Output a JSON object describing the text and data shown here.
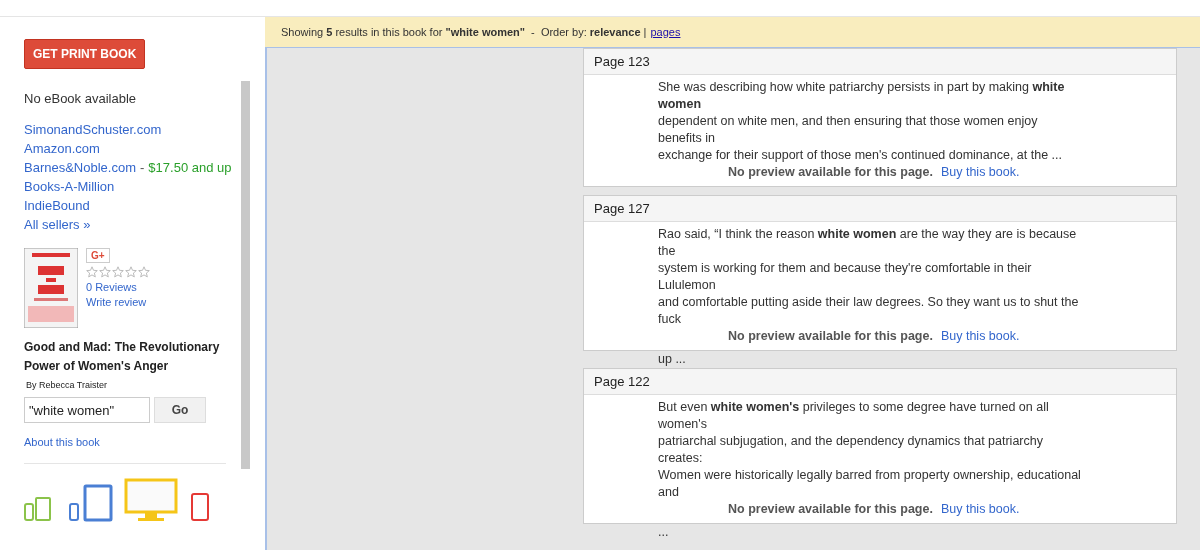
{
  "sidebar": {
    "get_print_button": "GET PRINT BOOK",
    "ebook_status": "No eBook available",
    "sellers": [
      {
        "name": "SimonandSchuster.com"
      },
      {
        "name": "Amazon.com"
      },
      {
        "name": "Barnes&Noble.com",
        "separator": "-",
        "price": "$17.50 and up"
      },
      {
        "name": "Books-A-Million"
      },
      {
        "name": "IndieBound"
      },
      {
        "name": "All sellers »"
      }
    ],
    "book": {
      "gplus": "G+",
      "stars": 0,
      "reviews": "0 Reviews",
      "write_review": "Write review",
      "title": "Good and Mad: The Revolutionary Power of Women's Anger",
      "author": "By Rebecca Traister"
    },
    "search": {
      "value": "\"white women\"",
      "button": "Go"
    },
    "about_link": "About this book"
  },
  "results_bar": {
    "text": "Showing **5** results in this book for **\"white women\"**  -  Order by: **relevance** |",
    "pages_link": "pages"
  },
  "results": [
    {
      "page": "Page 123",
      "lines": [
        "She was describing how white patriarchy persists in part by making **white**",
        "**women**",
        "dependent on white men, and then ensuring that those women enjoy",
        "benefits in",
        "exchange for their support of those men's continued dominance, at the ..."
      ],
      "notice": "No preview available for this page.",
      "buy_link": "Buy this book."
    },
    {
      "page": "Page 127",
      "lines": [
        "Rao said, “I think the reason **white women** are the way they are is because",
        "the",
        "system is working for them and because they're comfortable in their",
        "Lululemon",
        "and comfortable putting aside their law degrees. So they want us to shut the",
        "fuck"
      ],
      "after": [
        "up ..."
      ],
      "notice": "No preview available for this page.",
      "buy_link": "Buy this book."
    },
    {
      "page": "Page 122",
      "lines": [
        "But even **white women's** privileges to some degree have turned on all",
        "women's",
        "patriarchal subjugation, and the dependency dynamics that patriarchy",
        "creates:",
        "Women were historically legally barred from property ownership, educational",
        "and"
      ],
      "after": [
        "..."
      ],
      "notice": "No preview available for this page.",
      "buy_link": "Buy this book."
    }
  ]
}
